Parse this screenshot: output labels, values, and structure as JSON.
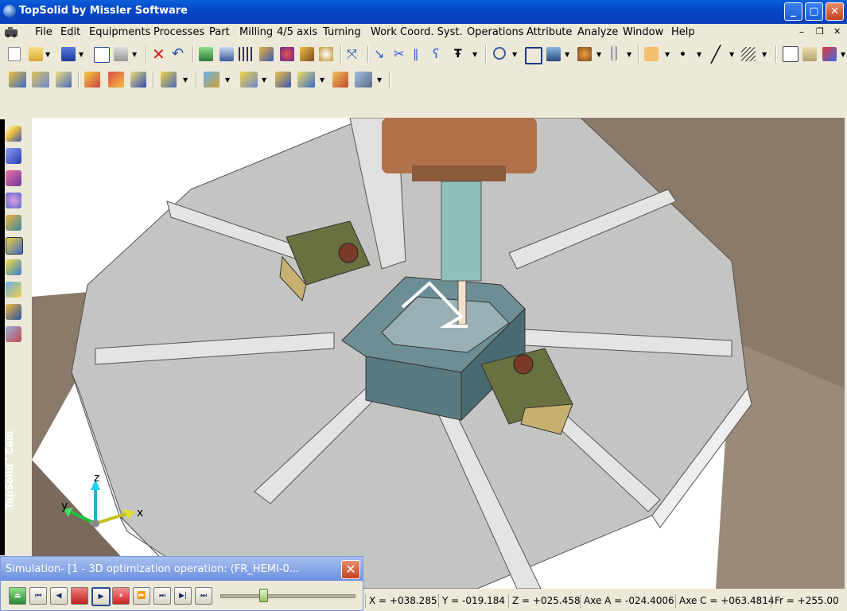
{
  "window": {
    "title": "TopSolid by Missler Software",
    "controls": {
      "minimize": "_",
      "maximize": "▢",
      "close": "✕"
    },
    "mdi_controls": {
      "minimize": "–",
      "restore": "❐",
      "close": "✕"
    }
  },
  "menu": {
    "items": [
      "File",
      "Edit",
      "Equipments",
      "Processes",
      "Part",
      "Milling",
      "4/5 axis",
      "Turning",
      "Work Coord. Syst.",
      "Operations",
      "Attribute",
      "Analyze",
      "Window",
      "Help"
    ]
  },
  "toolbar1": {
    "icons": [
      "new-icon",
      "open-icon",
      "save-icon",
      "properties-icon",
      "print-icon",
      "delete-icon",
      "undo-icon",
      "regenerate-icon",
      "zoom-icon",
      "sliders-icon",
      "hammer-icon",
      "pin-icon",
      "brush-icon",
      "hat-icon",
      "axis-icon",
      "curve-icon",
      "cut-icon",
      "parallel-icon",
      "hook-icon",
      "text-icon",
      "magnify-icon",
      "zoom-fit-icon",
      "view-icon",
      "render-icon",
      "layer-icon",
      "color-swatch-icon",
      "point-style-icon",
      "line-style-icon",
      "hatch-icon",
      "select-icon",
      "frame-icon",
      "palette-icon"
    ]
  },
  "toolbar2": {
    "icons": [
      "cam-setup-icon",
      "cam-tools-icon",
      "cam-fixture-icon",
      "cam-stock-icon",
      "cam-part-icon",
      "cam-machine-icon",
      "cam-operation-icon",
      "cam-pocket-icon",
      "cam-contour-icon",
      "cam-drill-icon",
      "cam-sim-icon",
      "cam-post-icon",
      "cam-robot-icon"
    ]
  },
  "left_toolbar": {
    "icons": [
      "sketch-icon",
      "solid-icon",
      "surface-icon",
      "assembly-icon",
      "machine-icon",
      "cam-icon",
      "flow-icon",
      "ops-icon",
      "tools-icon",
      "post-icon"
    ],
    "brand": "TopSolid ' Cam"
  },
  "viewport": {
    "axis_labels": {
      "x": "x",
      "y": "y",
      "z": "z"
    },
    "colors": {
      "table": "#c8c8c8",
      "base": "#8a7a6a",
      "vise": "#5e7e86",
      "clamp": "#6a7040",
      "spindle": "#b0704a",
      "tool": "#8fbfb8"
    }
  },
  "simulation": {
    "title": "Simulation- [1 - 3D optimization operation:    (FR_HEMI-0...",
    "close": "✕",
    "buttons": [
      "eject-button",
      "first-button",
      "prev-button",
      "stop-button",
      "play-button",
      "pause-button",
      "fast-forward-button",
      "step-forward-button",
      "next-button",
      "last-button"
    ],
    "progress": 0.32
  },
  "status": {
    "x": "X = +038.285",
    "y": "Y = -019.184",
    "z": "Z = +025.458",
    "axe_a": "Axe A = -024.4006",
    "axe_c": "Axe C = +063.4814",
    "fr": "Fr = +255.00"
  }
}
